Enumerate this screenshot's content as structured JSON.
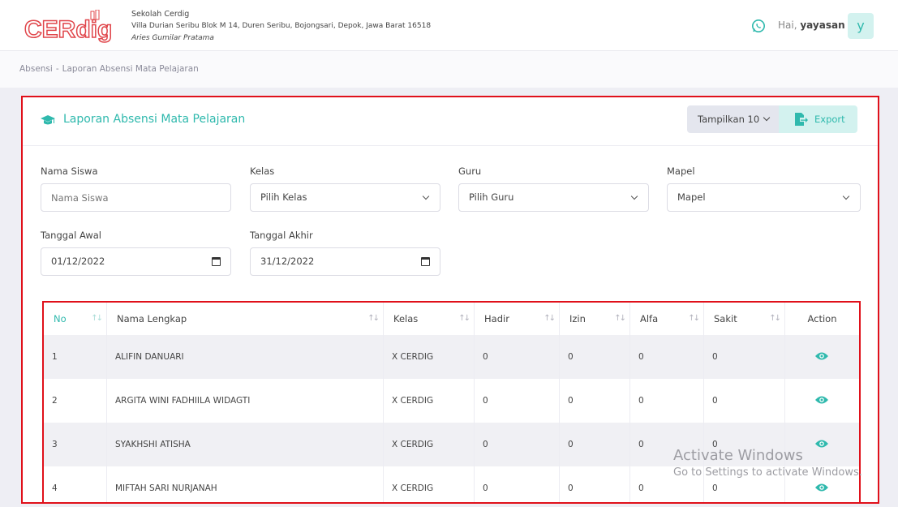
{
  "header": {
    "logo_text": "CERdig",
    "school_name": "Sekolah Cerdig",
    "school_address": "Villa Durian Seribu Blok M 14, Duren Seribu, Bojongsari, Depok, Jawa Barat 16518",
    "school_person": "Aries Gumilar Pratama",
    "greeting_prefix": "Hai,",
    "greeting_user": "yayasan",
    "avatar_letter": "y"
  },
  "breadcrumb": {
    "items": [
      "Absensi",
      "Laporan Absensi Mata Pelajaran"
    ],
    "separator": "-"
  },
  "card": {
    "title": "Laporan Absensi Mata Pelajaran",
    "show_label": "Tampilkan 10",
    "export_label": "Export"
  },
  "filters": {
    "nama_siswa": {
      "label": "Nama Siswa",
      "placeholder": "Nama Siswa"
    },
    "kelas": {
      "label": "Kelas",
      "value": "Pilih Kelas"
    },
    "guru": {
      "label": "Guru",
      "value": "Pilih Guru"
    },
    "mapel": {
      "label": "Mapel",
      "value": "Mapel"
    },
    "tanggal_awal": {
      "label": "Tanggal Awal",
      "value": "01/12/2022"
    },
    "tanggal_akhir": {
      "label": "Tanggal Akhir",
      "value": "31/12/2022"
    }
  },
  "table": {
    "columns": [
      "No",
      "Nama Lengkap",
      "Kelas",
      "Hadir",
      "Izin",
      "Alfa",
      "Sakit",
      "Action"
    ],
    "rows": [
      {
        "no": "1",
        "nama": "ALIFIN DANUARI",
        "kelas": "X CERDIG",
        "hadir": "0",
        "izin": "0",
        "alfa": "0",
        "sakit": "0"
      },
      {
        "no": "2",
        "nama": "ARGITA WINI FADHIILA WIDAGTI",
        "kelas": "X CERDIG",
        "hadir": "0",
        "izin": "0",
        "alfa": "0",
        "sakit": "0"
      },
      {
        "no": "3",
        "nama": "SYAKHSHI ATISHA",
        "kelas": "X CERDIG",
        "hadir": "0",
        "izin": "0",
        "alfa": "0",
        "sakit": "0"
      },
      {
        "no": "4",
        "nama": "MIFTAH SARI NURJANAH",
        "kelas": "X CERDIG",
        "hadir": "0",
        "izin": "0",
        "alfa": "0",
        "sakit": "0"
      }
    ]
  },
  "watermark": {
    "line1": "Activate Windows",
    "line2": "Go to Settings to activate Windows."
  },
  "colors": {
    "accent": "#2fb9ad",
    "accent_light": "#d3f2ef",
    "highlight_border": "#e0101a",
    "logo_red": "#e0454a"
  },
  "icons": [
    "logo",
    "whatsapp-icon",
    "graduation-cap-icon",
    "chevron-down-icon",
    "export-icon",
    "calendar-icon",
    "sort-icon",
    "eye-icon"
  ]
}
